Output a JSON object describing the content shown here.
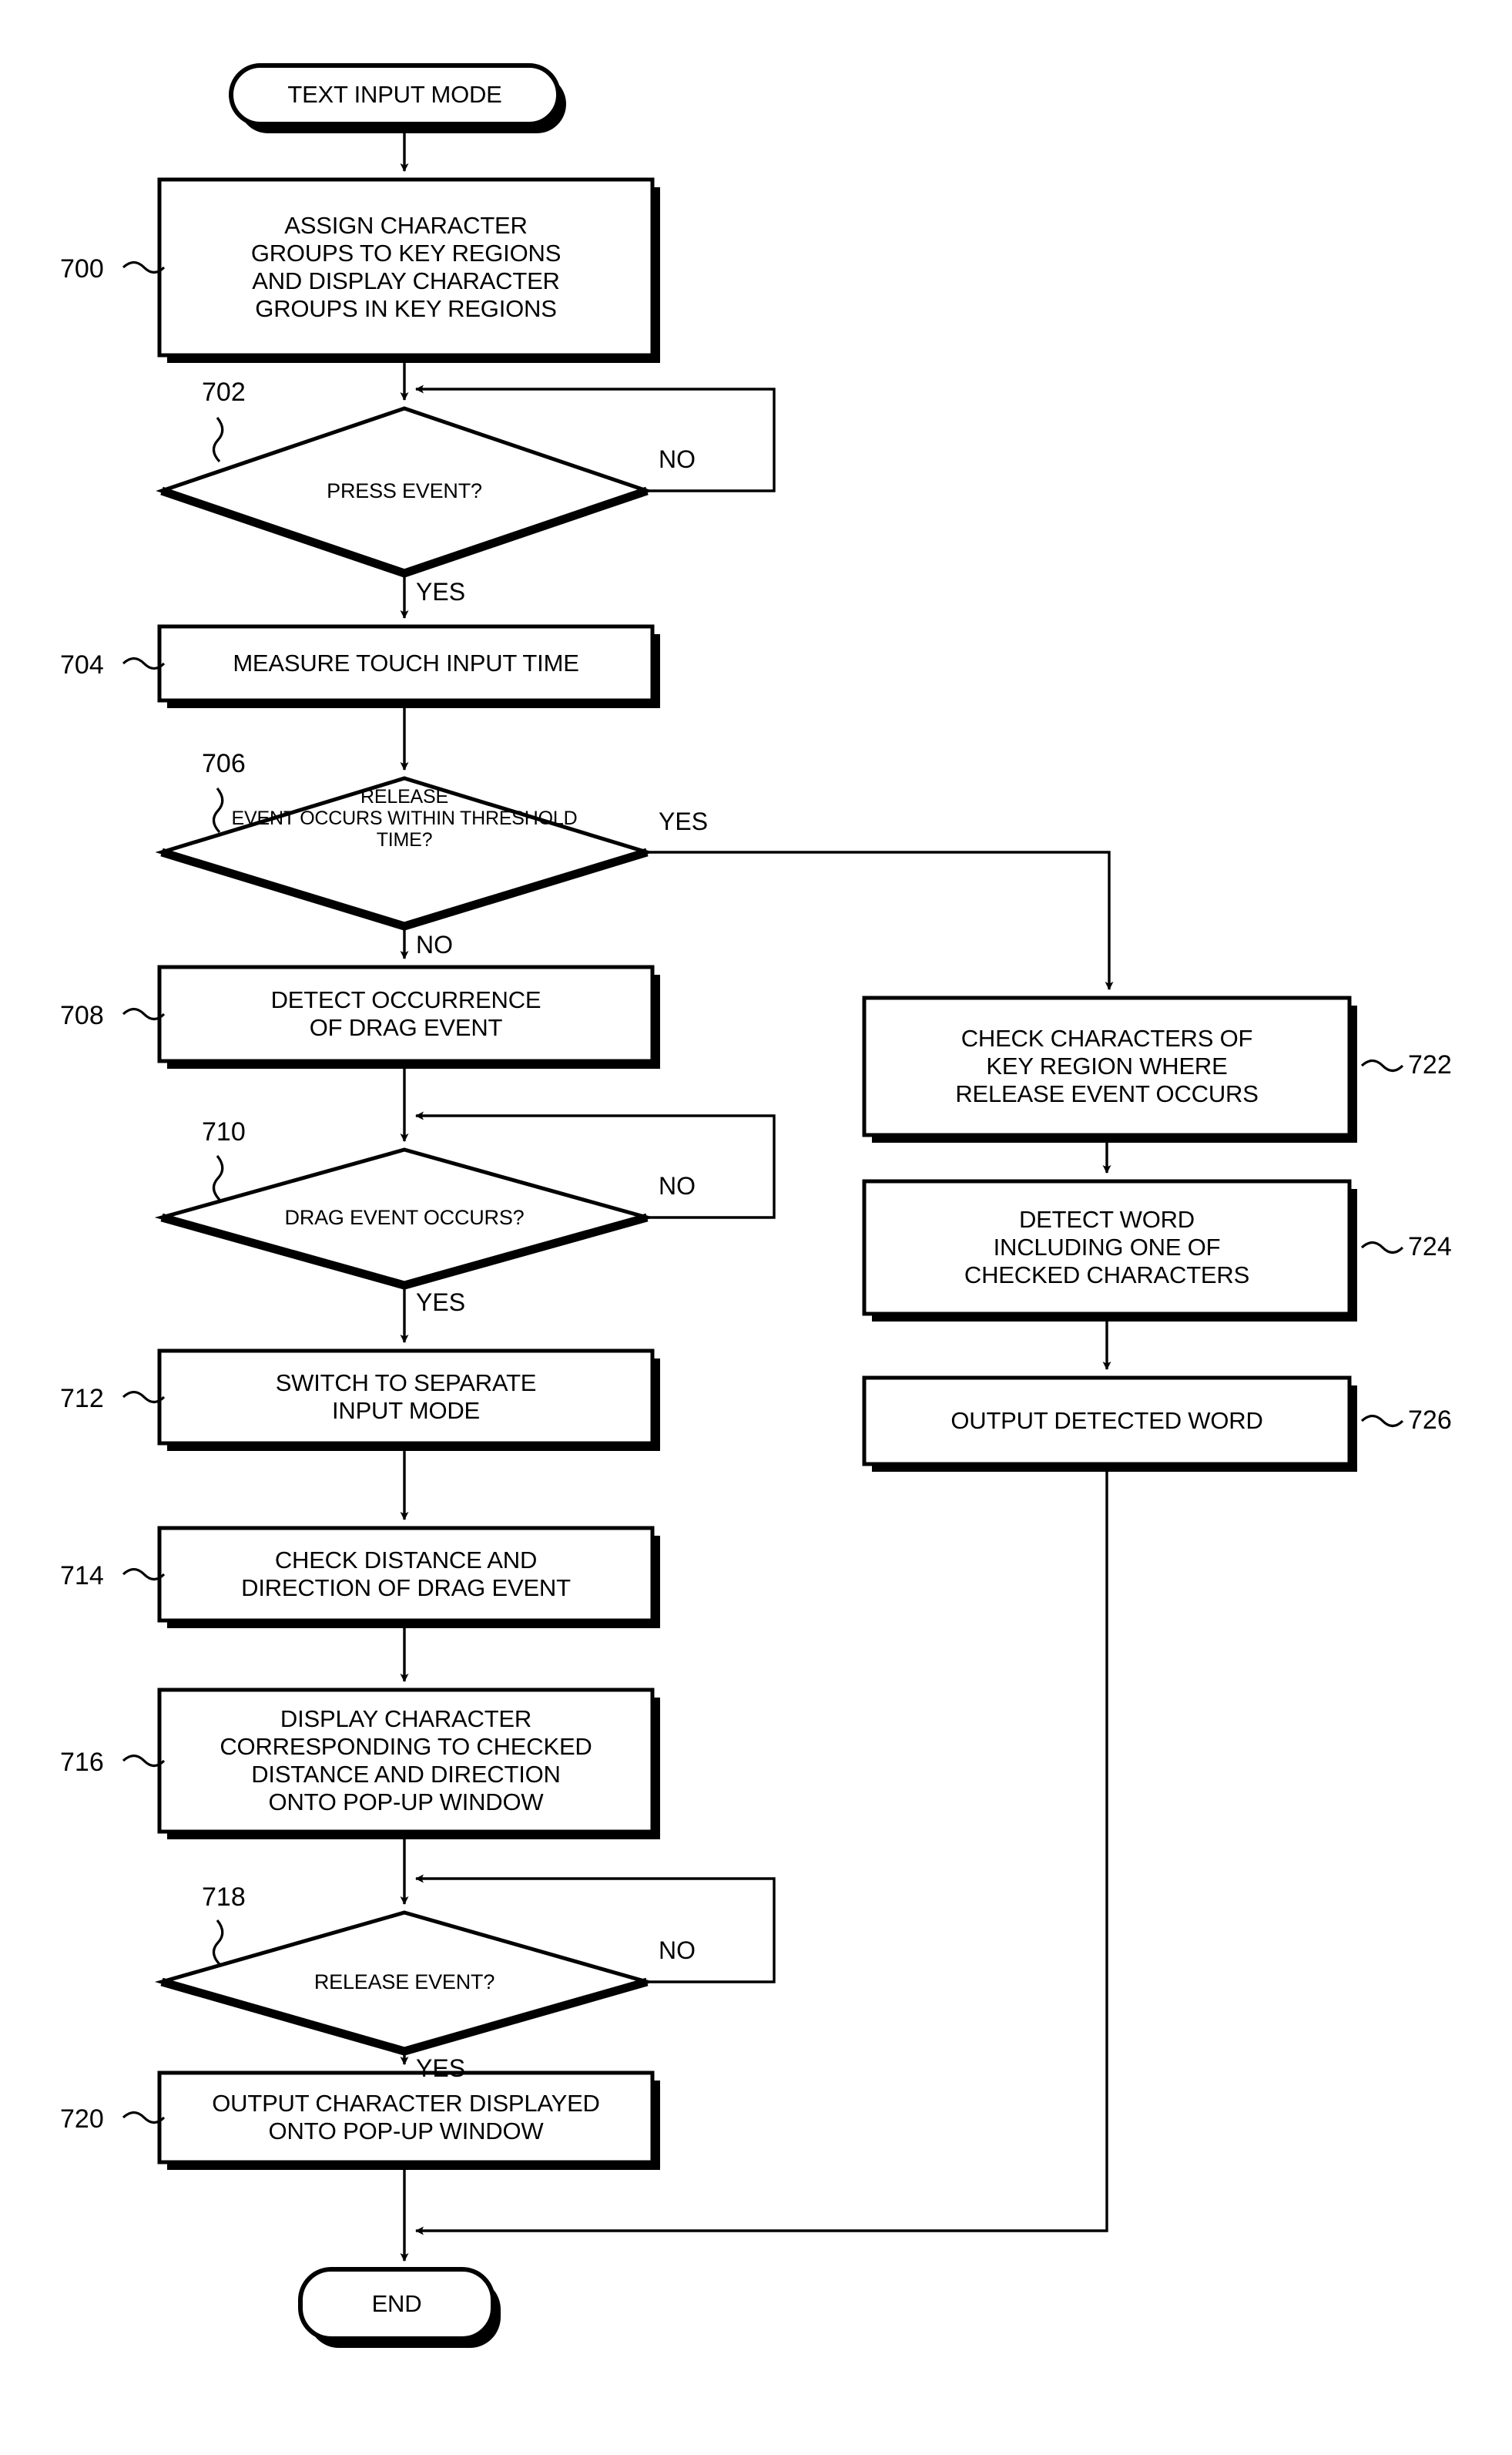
{
  "diagram": {
    "type": "flowchart",
    "title": "",
    "nodes": [
      {
        "id": "start",
        "shape": "terminator",
        "ref": "",
        "lines": [
          "TEXT INPUT MODE"
        ]
      },
      {
        "id": "n700",
        "shape": "process",
        "ref": "700",
        "lines": [
          "ASSIGN CHARACTER",
          "GROUPS TO KEY REGIONS",
          "AND DISPLAY CHARACTER",
          "GROUPS IN KEY REGIONS"
        ]
      },
      {
        "id": "n702",
        "shape": "decision",
        "ref": "702",
        "lines": [
          "PRESS EVENT?"
        ]
      },
      {
        "id": "n704",
        "shape": "process",
        "ref": "704",
        "lines": [
          "MEASURE TOUCH INPUT TIME"
        ]
      },
      {
        "id": "n706",
        "shape": "decision",
        "ref": "706",
        "lines": [
          "RELEASE",
          "EVENT OCCURS WITHIN THRESHOLD",
          "TIME?"
        ]
      },
      {
        "id": "n708",
        "shape": "process",
        "ref": "708",
        "lines": [
          "DETECT OCCURRENCE",
          "OF DRAG EVENT"
        ]
      },
      {
        "id": "n710",
        "shape": "decision",
        "ref": "710",
        "lines": [
          "DRAG EVENT OCCURS?"
        ]
      },
      {
        "id": "n712",
        "shape": "process",
        "ref": "712",
        "lines": [
          "SWITCH TO SEPARATE",
          "INPUT MODE"
        ]
      },
      {
        "id": "n714",
        "shape": "process",
        "ref": "714",
        "lines": [
          "CHECK DISTANCE AND",
          "DIRECTION OF DRAG EVENT"
        ]
      },
      {
        "id": "n716",
        "shape": "process",
        "ref": "716",
        "lines": [
          "DISPLAY CHARACTER",
          "CORRESPONDING TO CHECKED",
          "DISTANCE AND DIRECTION",
          "ONTO POP-UP WINDOW"
        ]
      },
      {
        "id": "n718",
        "shape": "decision",
        "ref": "718",
        "lines": [
          "RELEASE EVENT?"
        ]
      },
      {
        "id": "n720",
        "shape": "process",
        "ref": "720",
        "lines": [
          "OUTPUT CHARACTER DISPLAYED",
          "ONTO POP-UP WINDOW"
        ]
      },
      {
        "id": "n722",
        "shape": "process",
        "ref": "722",
        "lines": [
          "CHECK CHARACTERS OF",
          "KEY REGION WHERE",
          "RELEASE EVENT OCCURS"
        ]
      },
      {
        "id": "n724",
        "shape": "process",
        "ref": "724",
        "lines": [
          "DETECT WORD",
          "INCLUDING ONE OF",
          "CHECKED CHARACTERS"
        ]
      },
      {
        "id": "n726",
        "shape": "process",
        "ref": "726",
        "lines": [
          "OUTPUT DETECTED WORD"
        ]
      },
      {
        "id": "end",
        "shape": "terminator",
        "ref": "",
        "lines": [
          "END"
        ]
      }
    ],
    "edge_labels": {
      "e702_no": "NO",
      "e702_yes": "YES",
      "e706_yes": "YES",
      "e706_no": "NO",
      "e710_no": "NO",
      "e710_yes": "YES",
      "e718_no": "NO",
      "e718_yes": "YES"
    },
    "colors": {
      "ink": "#000000",
      "paper": "#ffffff"
    }
  }
}
